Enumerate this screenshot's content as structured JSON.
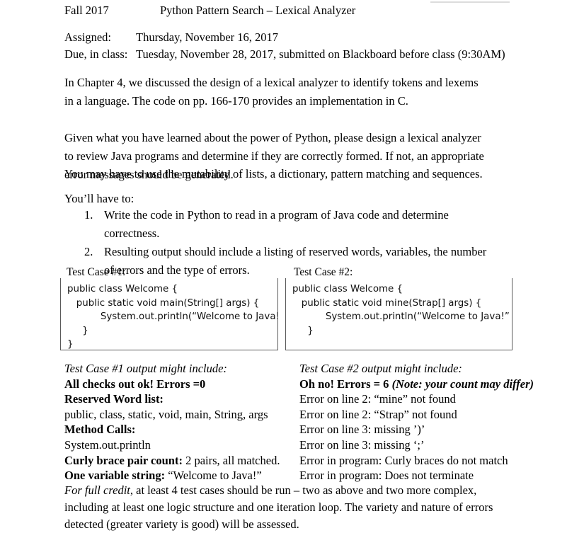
{
  "header": {
    "term": "Fall 2017",
    "title": "Python Pattern Search – Lexical Analyzer"
  },
  "meta": {
    "assigned_label": "Assigned:",
    "assigned_value": "Thursday, November 16, 2017",
    "due_label": "Due, in class:",
    "due_value": "Tuesday,   November 28, 2017, submitted on Blackboard before class (9:30AM)"
  },
  "body": {
    "paragraph_1": "In Chapter 4, we discussed the design of a lexical analyzer to identify tokens and lexems in a language.  The code on pp. 166-170 provides an implementation in C.",
    "paragraph_2": "Given what you have learned about the power of Python, please design a lexical analyzer to review Java programs and determine if they are correctly formed.  If not, an appropriate error messages should be generated.",
    "paragraph_3": "You may have to use the mutability of lists, a dictionary, pattern matching and sequences.",
    "youll_have_to": "You’ll have to:",
    "numbered_items": [
      {
        "num": "1.",
        "text": "Write the code in Python to read in a program of Java code and determine correctness."
      },
      {
        "num": "2.",
        "text": "Resulting output should include a listing of reserved words, variables, the number of errors and the type of errors."
      }
    ]
  },
  "test_cases": [
    {
      "label": "Test Case #1:",
      "code_lines": [
        "public class Welcome {",
        "   public static void main(String[] args) {",
        "           System.out.println(“Welcome to Java!”);",
        "     }",
        "}"
      ]
    },
    {
      "label": "Test Case #2:",
      "code_lines": [
        "public class Welcome {",
        "   public static void mine(Strap[] args) {",
        "           System.out.println(“Welcome to Java!”",
        "     }",
        ""
      ]
    }
  ],
  "outputs": {
    "column_1": {
      "heading": "Test Case #1 output might include:",
      "lines": [
        {
          "bold": "All checks out ok!  Errors =0",
          "plain": ""
        },
        {
          "bold": "Reserved Word list:",
          "plain": ""
        },
        {
          "bold": "",
          "plain": "public, class, static, void, main, String, args"
        },
        {
          "bold": "Method Calls:",
          "plain": ""
        },
        {
          "bold": "",
          "plain": "System.out.println"
        },
        {
          "bold": "Curly brace pair count:",
          "plain": " 2 pairs, all matched."
        },
        {
          "bold": "One variable string:",
          "plain": " “Welcome to Java!”"
        }
      ]
    },
    "column_2": {
      "heading": "Test Case #2 output might include:",
      "error_headline_bold": "Oh no!  Errors = 6",
      "error_headline_note": " (Note: your count may differ)",
      "error_lines": [
        "Error on line 2: “mine” not found",
        "Error on line 2: “Strap” not found",
        "Error on line 3: missing ’)’",
        "Error on line 3: missing ‘;’",
        "Error in program: Curly braces do not match",
        "Error in program: Does not terminate"
      ]
    }
  },
  "footer": {
    "lead_italic": "For full credit",
    "rest": ", at least 4 test cases should be run – two as above and two more complex, including at least one logic structure and one iteration loop.  The variety and nature of errors detected (greater variety is good) will be assessed."
  },
  "colors": {
    "page_background": "#ffffff",
    "text": "#000000",
    "box_border": "#5a5a5a",
    "scan_artifact": "#dcdcdc"
  }
}
